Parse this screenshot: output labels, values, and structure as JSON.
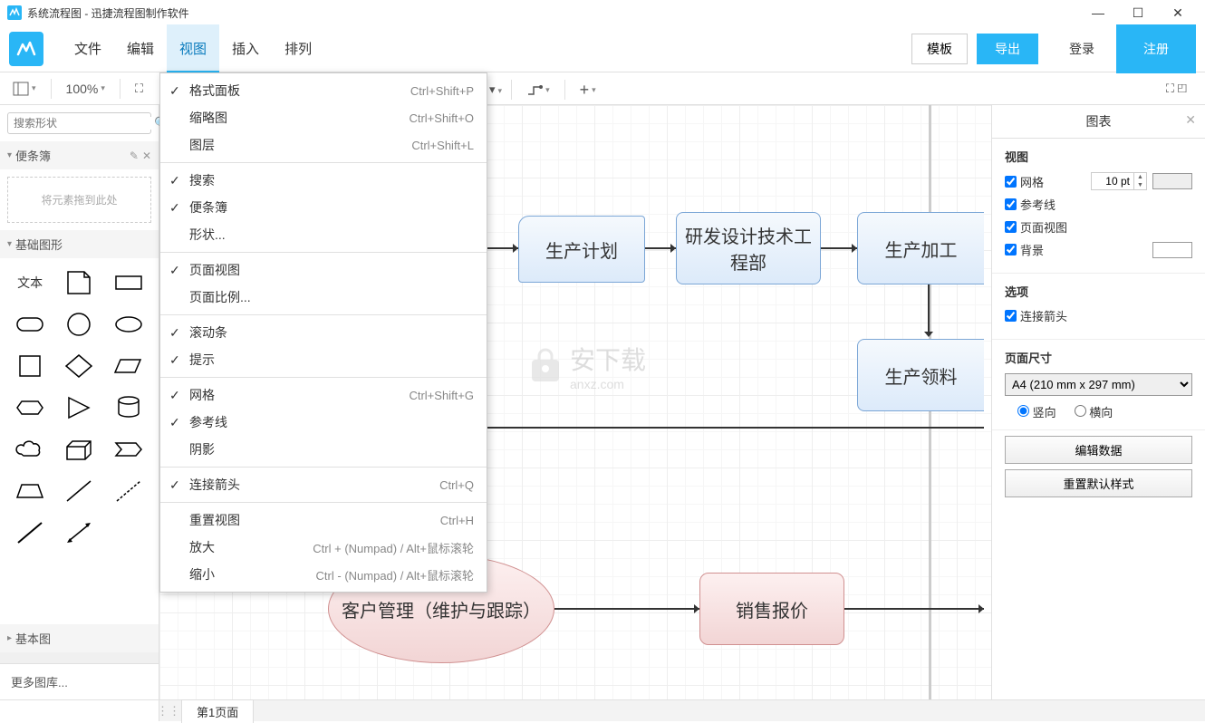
{
  "titlebar": {
    "title": "系统流程图 - 迅捷流程图制作软件"
  },
  "menus": [
    "文件",
    "编辑",
    "视图",
    "插入",
    "排列"
  ],
  "menubar_right": {
    "template": "模板",
    "export": "导出",
    "login": "登录",
    "register": "注册"
  },
  "toolbar": {
    "zoom": "100%"
  },
  "sidebar": {
    "search_placeholder": "搜索形状",
    "scratchpad": "便条簿",
    "drop_hint": "将元素拖到此处",
    "basic_shapes": "基础图形",
    "text_label": "文本",
    "basic_diagram": "基本图",
    "more": "更多图库..."
  },
  "dropdown": {
    "items": [
      {
        "label": "格式面板",
        "shortcut": "Ctrl+Shift+P",
        "checked": true
      },
      {
        "label": "缩略图",
        "shortcut": "Ctrl+Shift+O",
        "checked": false
      },
      {
        "label": "图层",
        "shortcut": "Ctrl+Shift+L",
        "checked": false
      },
      {
        "sep": true
      },
      {
        "label": "搜索",
        "shortcut": "",
        "checked": true
      },
      {
        "label": "便条簿",
        "shortcut": "",
        "checked": true
      },
      {
        "label": "形状...",
        "shortcut": "",
        "checked": false
      },
      {
        "sep": true
      },
      {
        "label": "页面视图",
        "shortcut": "",
        "checked": true
      },
      {
        "label": "页面比例...",
        "shortcut": "",
        "checked": false
      },
      {
        "sep": true
      },
      {
        "label": "滚动条",
        "shortcut": "",
        "checked": true
      },
      {
        "label": "提示",
        "shortcut": "",
        "checked": true
      },
      {
        "sep": true
      },
      {
        "label": "网格",
        "shortcut": "Ctrl+Shift+G",
        "checked": true
      },
      {
        "label": "参考线",
        "shortcut": "",
        "checked": true
      },
      {
        "label": "阴影",
        "shortcut": "",
        "checked": false
      },
      {
        "sep": true
      },
      {
        "label": "连接箭头",
        "shortcut": "Ctrl+Q",
        "checked": true
      },
      {
        "sep": true
      },
      {
        "label": "重置视图",
        "shortcut": "Ctrl+H",
        "checked": false
      },
      {
        "label": "放大",
        "shortcut": "Ctrl + (Numpad) / Alt+鼠标滚轮",
        "checked": false
      },
      {
        "label": "缩小",
        "shortcut": "Ctrl - (Numpad) / Alt+鼠标滚轮",
        "checked": false
      }
    ]
  },
  "canvas": {
    "nodes": {
      "plan": "生产计划",
      "rd": "研发设计技术工程部",
      "process": "生产加工",
      "material": "生产领料",
      "customer": "客户管理（维护与跟踪）",
      "quote": "销售报价"
    },
    "watermark_text": "安下载",
    "watermark_sub": "anxz.com"
  },
  "right_panel": {
    "title": "图表",
    "view_title": "视图",
    "grid": "网格",
    "grid_value": "10 pt",
    "guides": "参考线",
    "page_view": "页面视图",
    "background": "背景",
    "options_title": "选项",
    "conn_arrow": "连接箭头",
    "page_size_title": "页面尺寸",
    "page_size_value": "A4 (210 mm x 297 mm)",
    "portrait": "竖向",
    "landscape": "横向",
    "edit_data": "编辑数据",
    "reset_style": "重置默认样式"
  },
  "bottom": {
    "page_tab": "第1页面"
  }
}
